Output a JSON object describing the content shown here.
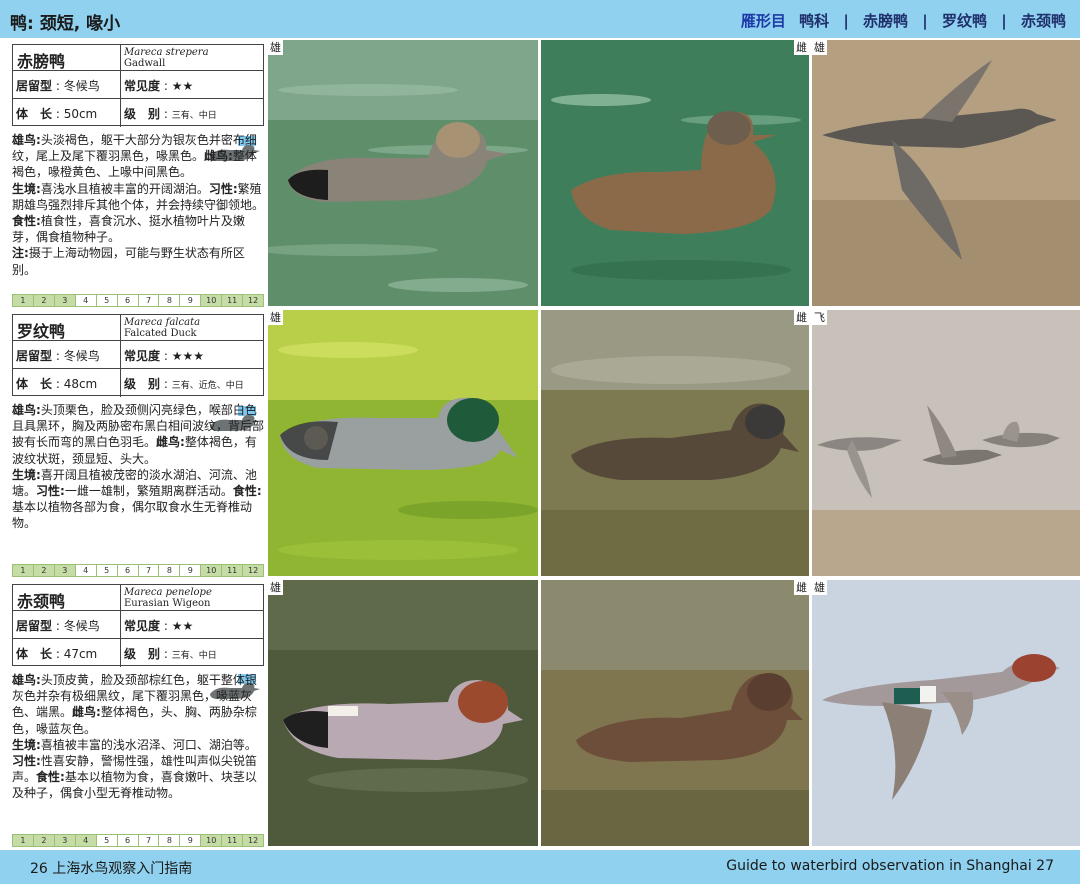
{
  "header": {
    "left_title": "鸭: 颈短, 喙小",
    "order": "雁形目",
    "family": "鸭科",
    "species_tabs": [
      "赤膀鸭",
      "罗纹鸭",
      "赤颈鸭"
    ]
  },
  "footer": {
    "left": "26  上海水鸟观察入门指南",
    "right": "Guide to waterbird observation in Shanghai  27"
  },
  "species": [
    {
      "name": "赤膀鸭",
      "sci": "Mareca strepera",
      "english": "Gadwall",
      "residency_label": "居留型",
      "residency": "冬候鸟",
      "frequency_label": "常见度",
      "frequency": "★★",
      "length_label": "体　长",
      "length": "50cm",
      "level_label": "级　别",
      "level": "三有、中日",
      "male_label": "雄鸟:",
      "male": "头淡褐色，躯干大部分为银灰色并密布细纹，尾上及尾下覆羽黑色，喙黑色。",
      "female_label": "雌鸟:",
      "female": "整体褐色，喙橙黄色、上喙中间黑色。",
      "habitat_label": "生境:",
      "habitat": "喜浅水且植被丰富的开阔湖泊。",
      "habit_label": "习性:",
      "habit": "繁殖期雄鸟强烈排斥其他个体，并会持续守御领地。",
      "food_label": "食性:",
      "food": "植食性，喜食沉水、挺水植物叶片及嫩芽，偶食植物种子。",
      "note_label": "注:",
      "note": "摄于上海动物园，可能与野生状态有所区别。",
      "months": [
        "1",
        "2",
        "3",
        "4",
        "5",
        "6",
        "7",
        "8",
        "9",
        "10",
        "11",
        "12"
      ],
      "active_months": [
        1,
        2,
        3,
        10,
        11,
        12
      ],
      "photo_tags": [
        [
          "雄"
        ],
        [
          "雌"
        ],
        [
          "雄"
        ]
      ]
    },
    {
      "name": "罗纹鸭",
      "sci": "Mareca falcata",
      "english": "Falcated Duck",
      "residency_label": "居留型",
      "residency": "冬候鸟",
      "frequency_label": "常见度",
      "frequency": "★★★",
      "length_label": "体　长",
      "length": "48cm",
      "level_label": "级　别",
      "level": "三有、近危、中日",
      "male_label": "雄鸟:",
      "male": "头顶栗色，脸及颈侧闪亮绿色，喉部白色且具黑环，胸及两胁密布黑白相间波纹，背后部披有长而弯的黑白色羽毛。",
      "female_label": "雌鸟:",
      "female": "整体褐色，有波纹状斑，颈显短、头大。",
      "habitat_label": "生境:",
      "habitat": "喜开阔且植被茂密的淡水湖泊、河流、池塘。",
      "habit_label": "习性:",
      "habit": "一雌一雄制，繁殖期离群活动。",
      "food_label": "食性:",
      "food": "基本以植物各部为食，偶尔取食水生无脊椎动物。",
      "months": [
        "1",
        "2",
        "3",
        "4",
        "5",
        "6",
        "7",
        "8",
        "9",
        "10",
        "11",
        "12"
      ],
      "active_months": [
        1,
        2,
        3,
        10,
        11,
        12
      ],
      "photo_tags": [
        [
          "雄"
        ],
        [
          "雌"
        ],
        [
          "飞"
        ]
      ]
    },
    {
      "name": "赤颈鸭",
      "sci": "Mareca penelope",
      "english": "Eurasian Wigeon",
      "residency_label": "居留型",
      "residency": "冬候鸟",
      "frequency_label": "常见度",
      "frequency": "★★",
      "length_label": "体　长",
      "length": "47cm",
      "level_label": "级　别",
      "level": "三有、中日",
      "male_label": "雄鸟:",
      "male": "头顶皮黄，脸及颈部棕红色，躯干整体银灰色并杂有极细黑纹，尾下覆羽黑色，喙蓝灰色、端黑。",
      "female_label": "雌鸟:",
      "female": "整体褐色，头、胸、两胁杂棕色，喙蓝灰色。",
      "habitat_label": "生境:",
      "habitat": "喜植被丰富的浅水沼泽、河口、湖泊等。",
      "habit_label": "习性:",
      "habit": "性喜安静，警惕性强，雄性叫声似尖锐笛声。",
      "food_label": "食性:",
      "food": "基本以植物为食，喜食嫩叶、块茎以及种子，偶食小型无脊椎动物。",
      "months": [
        "1",
        "2",
        "3",
        "4",
        "5",
        "6",
        "7",
        "8",
        "9",
        "10",
        "11",
        "12"
      ],
      "active_months": [
        1,
        2,
        3,
        4,
        10,
        11,
        12
      ],
      "photo_tags": [
        [
          "雄"
        ],
        [
          "雌"
        ],
        [
          "雄"
        ]
      ]
    }
  ]
}
